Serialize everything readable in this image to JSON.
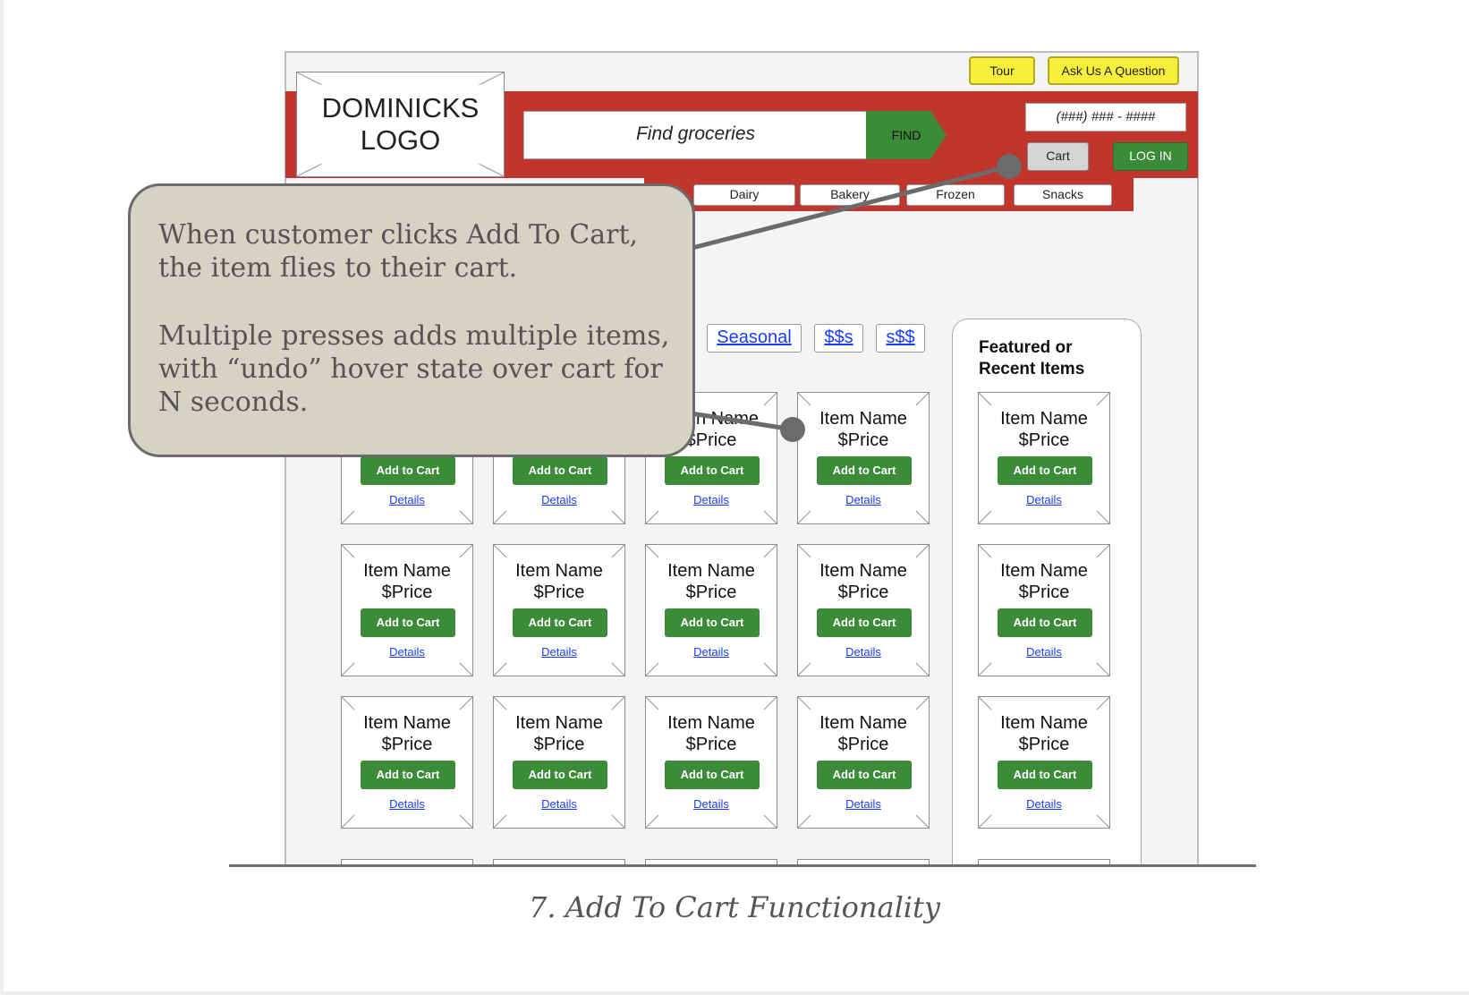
{
  "header": {
    "tour_label": "Tour",
    "ask_label": "Ask Us A Question",
    "logo_text_line1": "DOMINICKS",
    "logo_text_line2": "LOGO",
    "search_placeholder": "Find groceries",
    "find_label": "FIND",
    "phone": "(###) ### - ####",
    "cart_label": "Cart",
    "login_label": "LOG IN"
  },
  "categories": [
    "Dairy",
    "Bakery",
    "Frozen",
    "Snacks"
  ],
  "filters": [
    "Seasonal",
    "$$s",
    "s$$"
  ],
  "sidebar": {
    "title_line1": "Featured or",
    "title_line2": "Recent Items"
  },
  "tile": {
    "name": "Item Name",
    "price": "$Price",
    "add_label": "Add to Cart",
    "details_label": "Details",
    "partial_name": "n Name"
  },
  "callout": {
    "para1": "When customer clicks Add To Cart, the item flies to their cart.",
    "para2": "Multiple presses adds multiple items, with “undo” hover state over cart for N seconds."
  },
  "caption": "7. Add To Cart Functionality",
  "colors": {
    "red_bar": "#c0362d",
    "green_button": "#3c8b39",
    "yellow_button": "#f7ee3a",
    "callout_bg": "#d6d2c5",
    "link_blue": "#1a3cff"
  }
}
